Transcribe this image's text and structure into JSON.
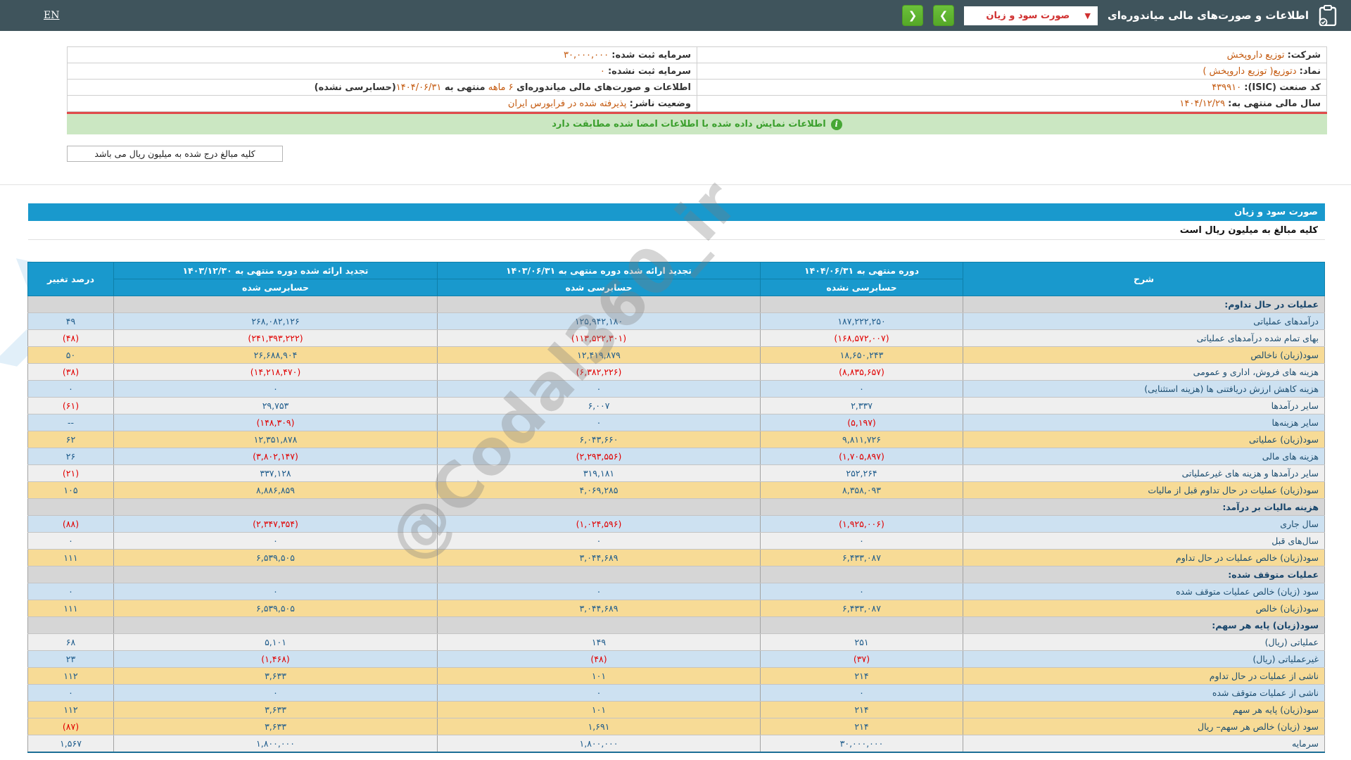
{
  "topbar": {
    "title": "اطلاعات و صورت‌های مالی میاندوره‌ای",
    "dropdown_value": "صورت سود و زیان",
    "dropdown_caret_icon": "chevron-down",
    "nav_next_icon": "chevron-right",
    "nav_prev_icon": "chevron-left",
    "en_label": "EN"
  },
  "company_info": {
    "rows": [
      {
        "right_label": "شرکت:",
        "right_value": "توزیع داروپخش",
        "left_label": "سرمایه ثبت شده:",
        "left_value": "۳۰,۰۰۰,۰۰۰"
      },
      {
        "right_label": "نماد:",
        "right_value": "دتوزیع( توزیع داروپخش )",
        "left_label": "سرمایه ثبت نشده:",
        "left_value": "۰"
      },
      {
        "right_label": "کد صنعت (ISIC):",
        "right_value": "۴۳۹۹۱۰",
        "left_parts": [
          "اطلاعات و صورت‌های مالی میاندوره‌ای ",
          "۶ ماهه ",
          "منتهی به ",
          "۱۴۰۴/۰۶/۳۱",
          "(حسابرسی نشده)"
        ]
      },
      {
        "right_label": "سال مالی منتهی به:",
        "right_value": "۱۴۰۴/۱۲/۲۹",
        "left_label": "وضعیت ناشر:",
        "left_value": "پذیرفته شده در فرابورس ایران"
      }
    ]
  },
  "banner": {
    "text": "اطلاعات نمایش داده شده با اطلاعات امضا شده مطابقت دارد",
    "icon": "info-circle"
  },
  "amounts_note": "کلیه مبالغ درج شده به میلیون ریال می باشد",
  "section_bar": {
    "title": "صورت سود و زیان"
  },
  "units_note": "کلیه مبالغ به میلیون ریال است",
  "statement": {
    "headers": {
      "desc": "شرح",
      "period_current": "دوره منتهی به ۱۴۰۴/۰۶/۳۱",
      "period_current_sub": "حسابرسی نشده",
      "period_restated_mid": "تجدید ارائه شده دوره منتهی به ۱۴۰۳/۰۶/۳۱",
      "period_restated_mid_sub": "حسابرسی شده",
      "period_restated_year": "تجدید ارائه شده دوره منتهی به ۱۴۰۳/۱۲/۳۰",
      "period_restated_year_sub": "حسابرسی شده",
      "pct_change": "درصد تغییر"
    },
    "rows": [
      {
        "type": "section",
        "label": "عملیات در حال تداوم:"
      },
      {
        "type": "data",
        "bg": "blue",
        "label": "درآمدهای عملیاتی",
        "values": [
          "۱۸۷,۲۲۲,۲۵۰",
          "۱۲۵,۹۴۲,۱۸۰",
          "۲۶۸,۰۸۲,۱۲۶",
          "۴۹"
        ]
      },
      {
        "type": "data",
        "bg": "gray",
        "label": "بهای تمام شده درآمدهای عملیاتی",
        "values": [
          "(۱۶۸,۵۷۲,۰۰۷)",
          "(۱۱۳,۵۲۲,۳۰۱)",
          "(۲۴۱,۳۹۳,۲۲۲)",
          "(۴۸)"
        ]
      },
      {
        "type": "data",
        "bg": "yellow",
        "label": "سود(زیان) ناخالص",
        "values": [
          "۱۸,۶۵۰,۲۴۳",
          "۱۲,۴۱۹,۸۷۹",
          "۲۶,۶۸۸,۹۰۴",
          "۵۰"
        ]
      },
      {
        "type": "data",
        "bg": "gray",
        "label": "هزینه های فروش، اداری و عمومی",
        "values": [
          "(۸,۸۳۵,۶۵۷)",
          "(۶,۳۸۲,۲۲۶)",
          "(۱۴,۲۱۸,۴۷۰)",
          "(۳۸)"
        ]
      },
      {
        "type": "data",
        "bg": "blue",
        "label": "هزینه کاهش ارزش دریافتنی ها (هزینه استثنایی)",
        "values": [
          "۰",
          "۰",
          "۰",
          "۰"
        ]
      },
      {
        "type": "data",
        "bg": "gray",
        "label": "سایر درآمدها",
        "values": [
          "۲,۳۳۷",
          "۶,۰۰۷",
          "۲۹,۷۵۳",
          "(۶۱)"
        ]
      },
      {
        "type": "data",
        "bg": "blue",
        "label": "سایر هزینه‌ها",
        "values": [
          "(۵,۱۹۷)",
          "۰",
          "(۱۴۸,۳۰۹)",
          "--"
        ]
      },
      {
        "type": "data",
        "bg": "yellow",
        "label": "سود(زیان) عملیاتی",
        "values": [
          "۹,۸۱۱,۷۲۶",
          "۶,۰۴۳,۶۶۰",
          "۱۲,۳۵۱,۸۷۸",
          "۶۲"
        ]
      },
      {
        "type": "data",
        "bg": "blue",
        "label": "هزینه های مالی",
        "values": [
          "(۱,۷۰۵,۸۹۷)",
          "(۲,۲۹۳,۵۵۶)",
          "(۳,۸۰۲,۱۴۷)",
          "۲۶"
        ]
      },
      {
        "type": "data",
        "bg": "gray",
        "label": "سایر درآمدها و هزینه های غیرعملیاتی",
        "values": [
          "۲۵۲,۲۶۴",
          "۳۱۹,۱۸۱",
          "۳۳۷,۱۲۸",
          "(۲۱)"
        ]
      },
      {
        "type": "data",
        "bg": "yellow",
        "label": "سود(زیان) عملیات در حال تداوم قبل از مالیات",
        "values": [
          "۸,۳۵۸,۰۹۳",
          "۴,۰۶۹,۲۸۵",
          "۸,۸۸۶,۸۵۹",
          "۱۰۵"
        ]
      },
      {
        "type": "section",
        "label": "هزینه مالیات بر درآمد:"
      },
      {
        "type": "data",
        "bg": "blue",
        "label": "سال جاری",
        "values": [
          "(۱,۹۲۵,۰۰۶)",
          "(۱,۰۲۴,۵۹۶)",
          "(۲,۳۴۷,۳۵۴)",
          "(۸۸)"
        ]
      },
      {
        "type": "data",
        "bg": "gray",
        "label": "سال‌های قبل",
        "values": [
          "۰",
          "۰",
          "۰",
          "۰"
        ]
      },
      {
        "type": "data",
        "bg": "yellow",
        "label": "سود(زیان) خالص عملیات در حال تداوم",
        "values": [
          "۶,۴۳۳,۰۸۷",
          "۳,۰۴۴,۶۸۹",
          "۶,۵۳۹,۵۰۵",
          "۱۱۱"
        ]
      },
      {
        "type": "section",
        "label": "عملیات متوقف شده:"
      },
      {
        "type": "data",
        "bg": "blue",
        "label": "سود (زیان) خالص عملیات متوقف شده",
        "values": [
          "۰",
          "۰",
          "۰",
          "۰"
        ]
      },
      {
        "type": "data",
        "bg": "yellow",
        "label": "سود(زیان) خالص",
        "values": [
          "۶,۴۳۳,۰۸۷",
          "۳,۰۴۴,۶۸۹",
          "۶,۵۳۹,۵۰۵",
          "۱۱۱"
        ]
      },
      {
        "type": "section",
        "label": "سود(زیان) پایه هر سهم:"
      },
      {
        "type": "data",
        "bg": "gray",
        "label": "عملیاتی (ریال)",
        "values": [
          "۲۵۱",
          "۱۴۹",
          "۵,۱۰۱",
          "۶۸"
        ]
      },
      {
        "type": "data",
        "bg": "blue",
        "label": "غیرعملیاتی (ریال)",
        "values": [
          "(۳۷)",
          "(۴۸)",
          "(۱,۴۶۸)",
          "۲۳"
        ]
      },
      {
        "type": "data",
        "bg": "yellow",
        "label": "ناشی از عملیات در حال تداوم",
        "values": [
          "۲۱۴",
          "۱۰۱",
          "۳,۶۳۳",
          "۱۱۲"
        ]
      },
      {
        "type": "data",
        "bg": "blue",
        "label": "ناشی از عملیات متوقف شده",
        "values": [
          "۰",
          "۰",
          "۰",
          "۰"
        ]
      },
      {
        "type": "data",
        "bg": "yellow",
        "label": "سود(زیان) پایه هر سهم",
        "values": [
          "۲۱۴",
          "۱۰۱",
          "۳,۶۳۳",
          "۱۱۲"
        ]
      },
      {
        "type": "data",
        "bg": "yellow",
        "label": "سود (زیان) خالص هر سهم– ریال",
        "values": [
          "۲۱۴",
          "۱,۶۹۱",
          "۳,۶۳۳",
          "(۸۷)"
        ]
      },
      {
        "type": "data",
        "bg": "gray",
        "label": "سرمایه",
        "values": [
          "۳۰,۰۰۰,۰۰۰",
          "۱,۸۰۰,۰۰۰",
          "۱,۸۰۰,۰۰۰",
          "۱,۵۶۷"
        ]
      }
    ]
  },
  "watermark": "@Codal360_ir",
  "colors": {
    "topbar_bg": "#3F545C",
    "header_blue": "#1999CD",
    "row_blue": "#CDE1F1",
    "row_gray": "#EFEFEF",
    "row_highlight_yellow": "#F7DB96",
    "section_gray": "#D6D6D6",
    "negative_red": "#E10000",
    "value_navy": "#1F5C8C",
    "info_value_orange": "#C4590E",
    "banner_green_bg": "#CBE7C2",
    "banner_green_text": "#3A9F2C",
    "nav_button_green": "#5FB630",
    "dropdown_text_red": "#D03030"
  }
}
